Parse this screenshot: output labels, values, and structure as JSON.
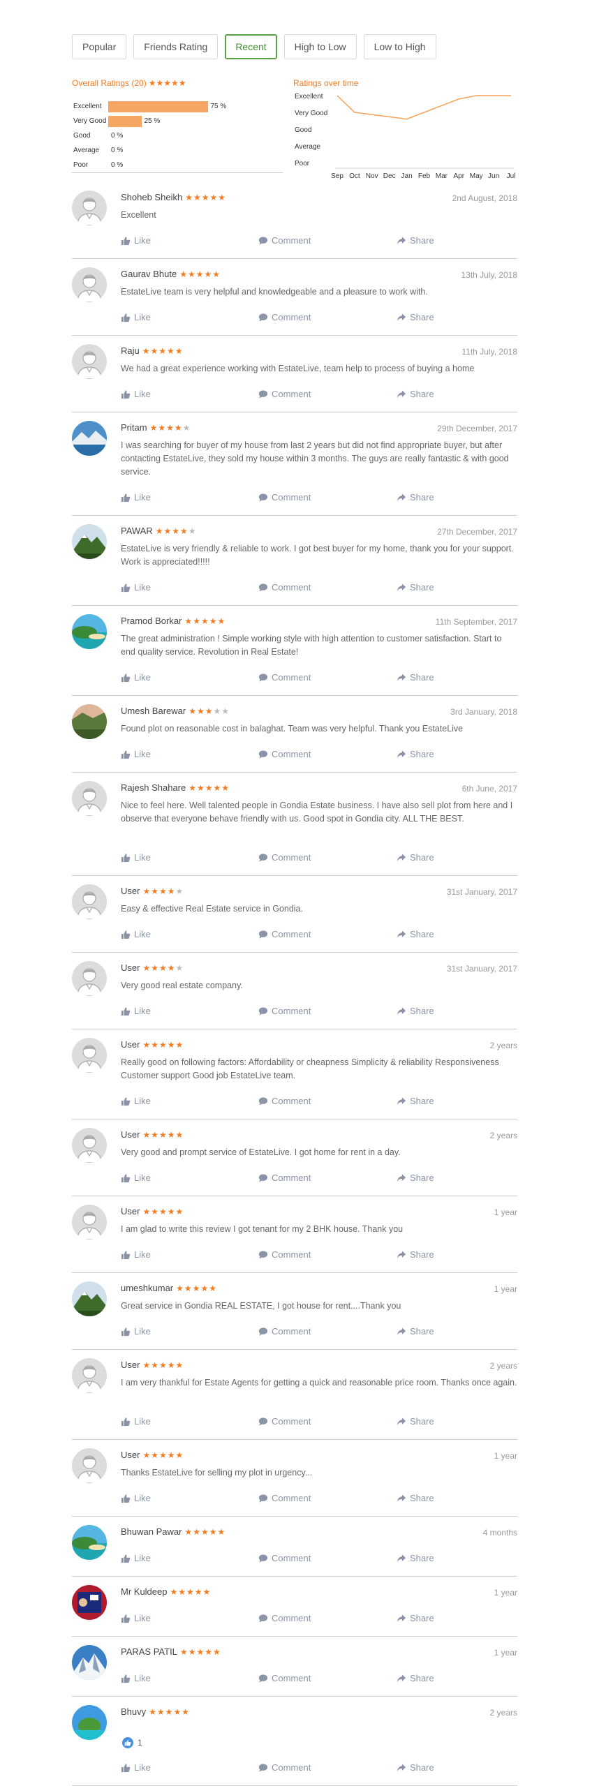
{
  "tabs": [
    {
      "label": "Popular",
      "active": false
    },
    {
      "label": "Friends Rating",
      "active": false
    },
    {
      "label": "Recent",
      "active": true
    },
    {
      "label": "High to Low",
      "active": false
    },
    {
      "label": "Low to High",
      "active": false
    }
  ],
  "overall": {
    "title": "Overall Ratings (20)",
    "stars": "★★★★★",
    "rows": [
      {
        "label": "Excellent",
        "percent": 75,
        "text": "75 %"
      },
      {
        "label": "Very Good",
        "percent": 25,
        "text": "25 %"
      },
      {
        "label": "Good",
        "percent": 0,
        "text": "0 %"
      },
      {
        "label": "Average",
        "percent": 0,
        "text": "0 %"
      },
      {
        "label": "Poor",
        "percent": 0,
        "text": "0 %"
      }
    ]
  },
  "chart_data": {
    "type": "line",
    "title": "Ratings over time",
    "categories": [
      "Sep",
      "Oct",
      "Nov",
      "Dec",
      "Jan",
      "Feb",
      "Mar",
      "Apr",
      "May",
      "Jun",
      "Jul"
    ],
    "y_categories": [
      "Excellent",
      "Very Good",
      "Good",
      "Average",
      "Poor"
    ],
    "series": [
      {
        "values": [
          5,
          4,
          null,
          null,
          3.6,
          null,
          null,
          4.8,
          5,
          5,
          5
        ]
      }
    ],
    "colors": {
      "line": "#f7a055"
    }
  },
  "actions": {
    "like": "Like",
    "comment": "Comment",
    "share": "Share"
  },
  "reviews": [
    {
      "name": "Shoheb Sheikh",
      "rating": 5,
      "date": "2nd August, 2018",
      "text": "Excellent",
      "avatar": "person"
    },
    {
      "name": "Gaurav Bhute",
      "rating": 5,
      "date": "13th July, 2018",
      "text": "EstateLive team is very helpful and knowledgeable and a pleasure to work with.",
      "avatar": "person"
    },
    {
      "name": "Raju",
      "rating": 5,
      "date": "11th July, 2018",
      "text": "We had a great experience working with EstateLive, team help to process of buying a home",
      "avatar": "person"
    },
    {
      "name": "Pritam",
      "rating": 4,
      "date": "29th December, 2017",
      "text": "I was searching for buyer of my house from last 2 years but did not find appropriate buyer, but after contacting EstateLive, they sold my house within 3 months. The guys are really fantastic & with good service.",
      "avatar": "lake"
    },
    {
      "name": "PAWAR",
      "rating": 4,
      "date": "27th December, 2017",
      "text": "EstateLive is very friendly & reliable to work. I got best buyer for my home, thank you for your support. Work is appreciated!!!!!",
      "avatar": "mountain"
    },
    {
      "name": "Pramod Borkar",
      "rating": 5,
      "date": "11th September, 2017",
      "text": "The great administration ! Simple working style with high attention to customer satisfaction. Start to end quality service. Revolution in Real Estate!",
      "avatar": "beach"
    },
    {
      "name": "Umesh Barewar",
      "rating": 3,
      "date": "3rd January, 2018",
      "text": "Found plot on reasonable cost in balaghat. Team was very helpful. Thank you EstateLive",
      "avatar": "valley"
    },
    {
      "name": "Rajesh Shahare",
      "rating": 5,
      "date": "6th June, 2017",
      "text": "Nice to feel here. Well talented people in Gondia Estate business. I have also sell plot from here and I observe that everyone behave friendly with us. Good spot in Gondia city. ALL THE BEST.",
      "avatar": "person"
    },
    {
      "name": "User",
      "rating": 4,
      "date": "31st January, 2017",
      "text": "Easy & effective Real Estate service in Gondia.",
      "avatar": "person"
    },
    {
      "name": "User",
      "rating": 4,
      "date": "31st January, 2017",
      "text": "Very good real estate company.",
      "avatar": "person"
    },
    {
      "name": "User",
      "rating": 5,
      "date": "2 years",
      "text": "Really good on following factors: Affordability or cheapness Simplicity & reliability Responsiveness Customer support Good job EstateLive team.",
      "avatar": "person"
    },
    {
      "name": "User",
      "rating": 5,
      "date": "2 years",
      "text": "Very good and prompt service of EstateLive. I got home for rent in a day.",
      "avatar": "person"
    },
    {
      "name": "User",
      "rating": 5,
      "date": "1 year",
      "text": "I am glad to write this review I got tenant for my 2 BHK house. Thank you",
      "avatar": "person"
    },
    {
      "name": "umeshkumar",
      "rating": 5,
      "date": "1 year",
      "text": "Great service in Gondia REAL ESTATE, I got house for rent....Thank you",
      "avatar": "mountain"
    },
    {
      "name": "User",
      "rating": 5,
      "date": "2 years",
      "text": "I am very thankful for Estate Agents for getting a quick and reasonable price room. Thanks once again.",
      "avatar": "person"
    },
    {
      "name": "User",
      "rating": 5,
      "date": "1 year",
      "text": "Thanks EstateLive for selling my plot in urgency...",
      "avatar": "person"
    },
    {
      "name": "Bhuwan Pawar",
      "rating": 5,
      "date": "4 months",
      "text": "",
      "avatar": "beach"
    },
    {
      "name": "Mr Kuldeep",
      "rating": 5,
      "date": "1 year",
      "text": "",
      "avatar": "poster"
    },
    {
      "name": "PARAS PATIL",
      "rating": 5,
      "date": "1 year",
      "text": "",
      "avatar": "snow"
    },
    {
      "name": "Bhuvy",
      "rating": 5,
      "date": "2 years",
      "text": "",
      "avatar": "island",
      "likes": "1"
    }
  ]
}
